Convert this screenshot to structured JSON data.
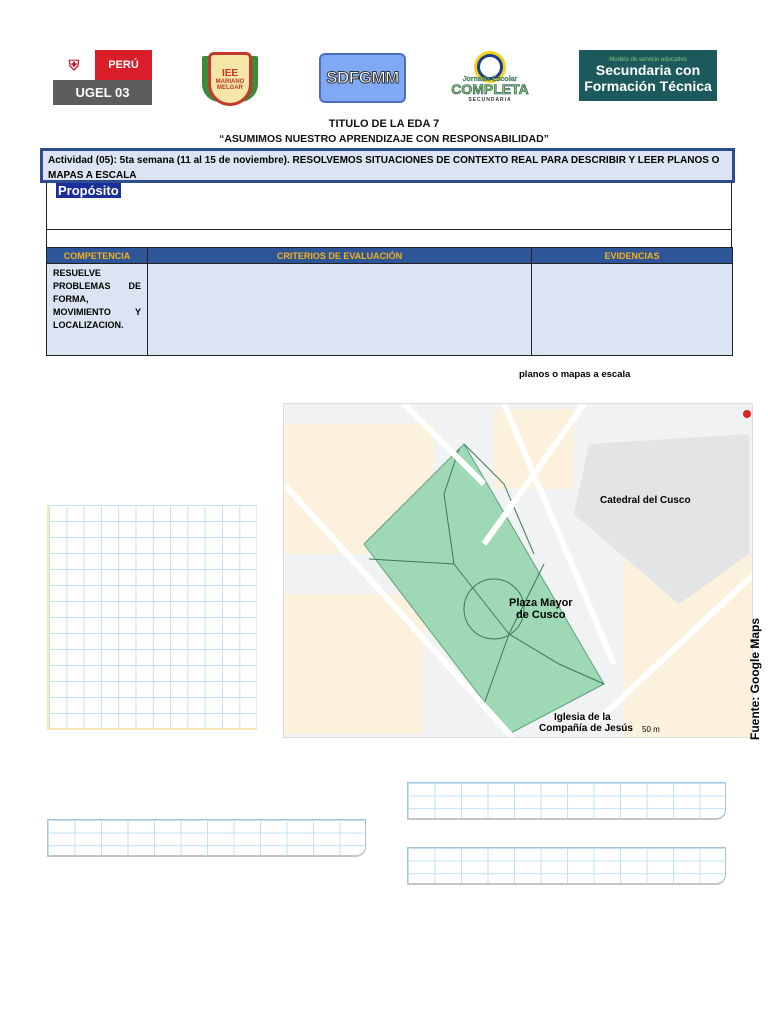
{
  "logos": {
    "ugel": {
      "country": "PERÚ",
      "name": "UGEL 03"
    },
    "school": {
      "initials": "IEE",
      "line1": "MARIANO",
      "line2": "MELGAR"
    },
    "sdfgmm": "SDFGMM",
    "jornada": {
      "line1": "Jornada Escolar",
      "line2": "COMPLETA",
      "line3": "SECUNDARIA"
    },
    "secundaria": {
      "small": "Modelo de servicio educativo",
      "line1": "Secundaria con",
      "line2": "Formación Técnica"
    }
  },
  "header": {
    "title": "TITULO  DE LA EDA 7",
    "subtitle": "“ASUMIMOS NUESTRO APRENDIZAJE CON RESPONSABILIDAD”"
  },
  "activity": "Actividad  (05): 5ta  semana (11 al 15 de noviembre). RESOLVEMOS SITUACIONES DE CONTEXTO REAL PARA DESCRIBIR Y LEER PLANOS O MAPAS  A ESCALA",
  "purpose_label": "Propósito",
  "table": {
    "headers": [
      "COMPETENCIA",
      "CRITERIOS DE EVALUACIÓN",
      "EVIDENCIAS"
    ],
    "competencia": "RESUELVE PROBLEMAS DE FORMA, MOVIMIENTO Y LOCALIZACION."
  },
  "section_label": "planos o mapas a escala",
  "map": {
    "landmarks": [
      "Catedral del Cusco",
      "Plaza Mayor de Cusco",
      "Iglesia de la Compañía de Jesús"
    ],
    "scale": "50 m",
    "source": "Fuente: Google Maps"
  }
}
